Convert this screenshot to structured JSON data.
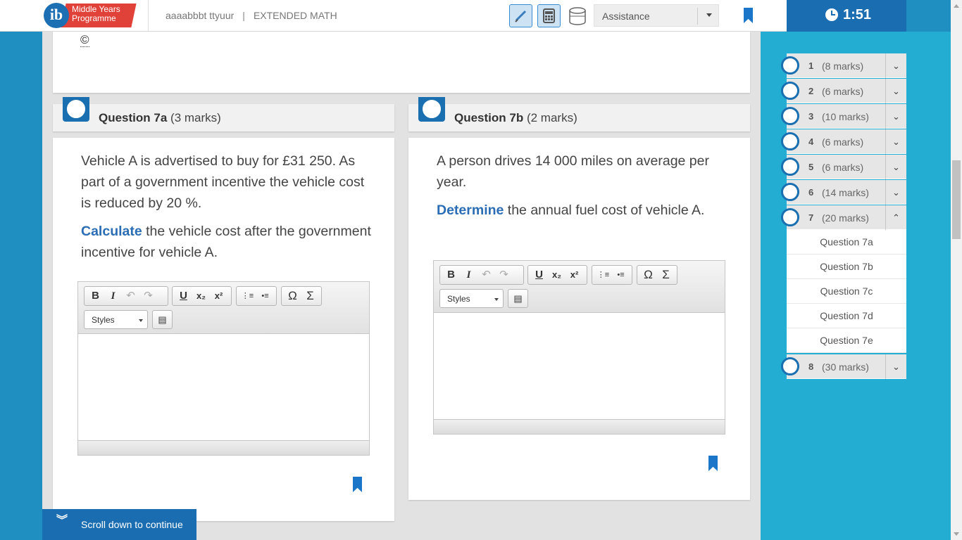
{
  "header": {
    "logo_line1": "Middle Years",
    "logo_line2": "Programme",
    "user": "aaaabbbt ttyuur",
    "separator": "|",
    "subject": "EXTENDED MATH",
    "assistance_label": "Assistance"
  },
  "timer": {
    "value": "1:51"
  },
  "previous": {
    "copyright": "©"
  },
  "questions": [
    {
      "id": "Question 7a",
      "marks": "(3 marks)",
      "paragraph1": "Vehicle A is advertised to buy for £31 250. As part of a government incentive the vehicle cost is reduced by 20 %.",
      "keyword": "Calculate",
      "paragraph2_rest": " the vehicle cost after the government incentive for vehicle A.",
      "styles_label": "Styles"
    },
    {
      "id": "Question 7b",
      "marks": "(2 marks)",
      "paragraph1": "A person drives 14 000 miles on average per year.",
      "keyword": "Determine",
      "paragraph2_rest": " the annual fuel cost of vehicle A.",
      "styles_label": "Styles"
    }
  ],
  "toolbar": {
    "bold": "B",
    "italic": "I",
    "undo": "↶",
    "redo": "↷",
    "underline": "U",
    "subscript": "x₂",
    "superscript": "x²",
    "ordered_list": "⋮≡",
    "bullet_list": "•≡",
    "special_char": "Ω",
    "sigma": "Σ",
    "source": "▤"
  },
  "scroll_hint": "Scroll down to continue",
  "sidebar": {
    "items": [
      {
        "num": "1",
        "marks": "(8 marks)",
        "toggle": "⌄"
      },
      {
        "num": "2",
        "marks": "(6 marks)",
        "toggle": "⌄"
      },
      {
        "num": "3",
        "marks": "(10 marks)",
        "toggle": "⌄"
      },
      {
        "num": "4",
        "marks": "(6 marks)",
        "toggle": "⌄"
      },
      {
        "num": "5",
        "marks": "(6 marks)",
        "toggle": "⌄"
      },
      {
        "num": "6",
        "marks": "(14 marks)",
        "toggle": "⌄"
      },
      {
        "num": "7",
        "marks": "(20 marks)",
        "toggle": "⌃"
      },
      {
        "num": "8",
        "marks": "(30 marks)",
        "toggle": "⌄"
      }
    ],
    "subitems": [
      "Question 7a",
      "Question 7b",
      "Question 7c",
      "Question 7d",
      "Question 7e"
    ]
  },
  "colors": {
    "accent": "#1a6db0",
    "sidebar": "#24add3",
    "keyword": "#2a6db4"
  },
  "icons": [
    "pencil-icon",
    "calculator-icon",
    "cylinder-icon",
    "bookmark-icon",
    "clock-icon"
  ]
}
